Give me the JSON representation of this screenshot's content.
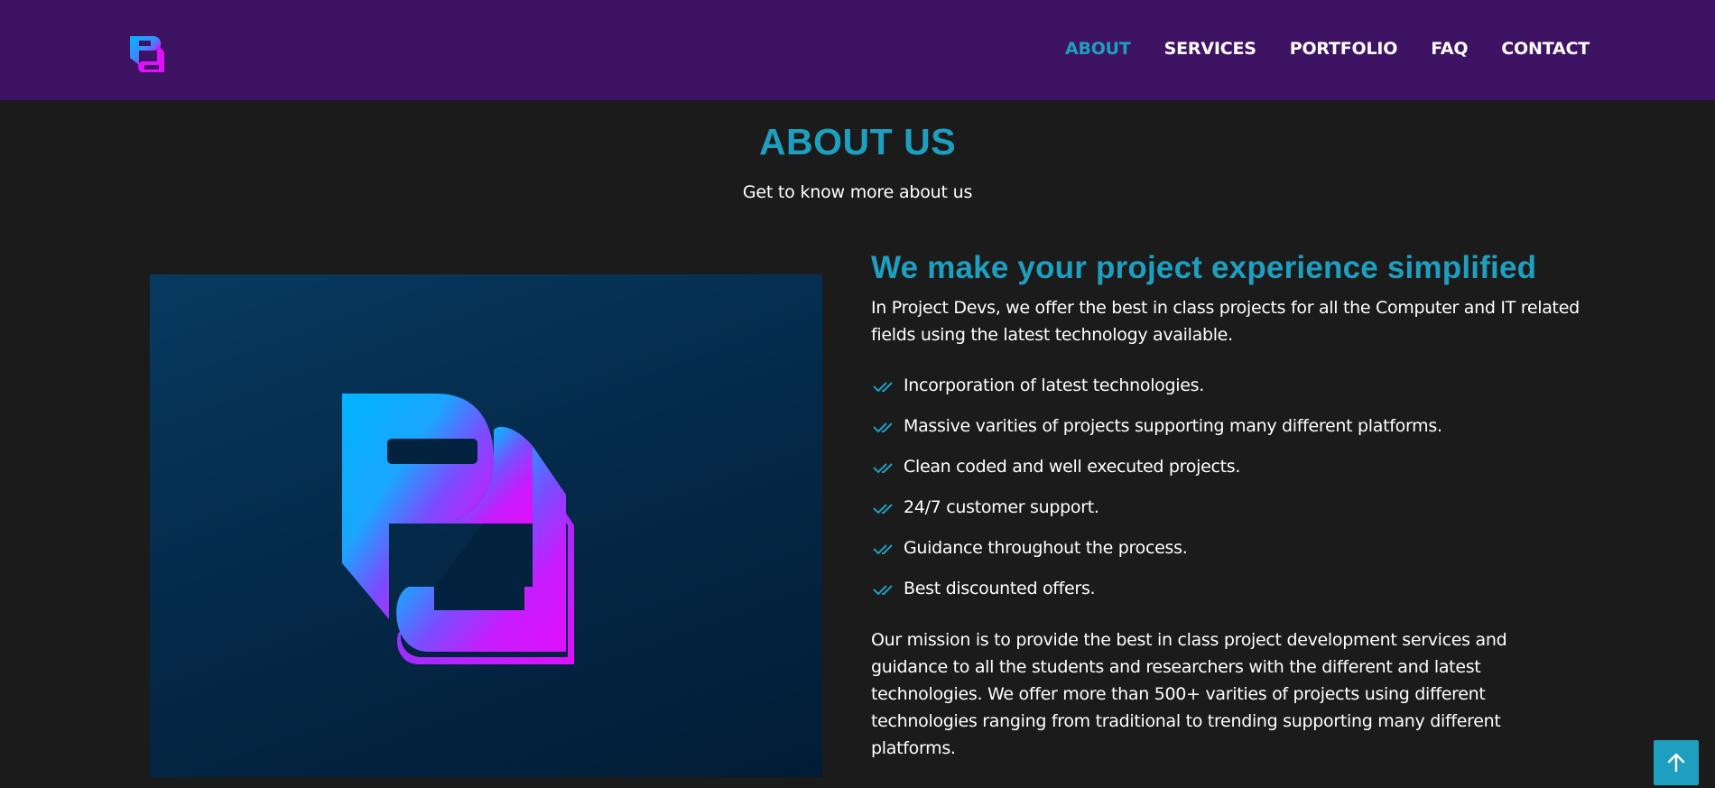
{
  "navbar": {
    "logo_alt": "Project Devs logo",
    "links": [
      {
        "label": "ABOUT",
        "active": true
      },
      {
        "label": "SERVICES",
        "active": false
      },
      {
        "label": "PORTFOLIO",
        "active": false
      },
      {
        "label": "FAQ",
        "active": false
      },
      {
        "label": "CONTACT",
        "active": false
      }
    ]
  },
  "about": {
    "title": "ABOUT US",
    "subtitle": "Get to know more about us",
    "heading": "We make your project experience simplified",
    "intro": "In Project Devs, we offer the best in class projects for all the Computer and IT related fields using the latest technology available.",
    "features": [
      "Incorporation of latest technologies.",
      "Massive varities of projects supporting many different platforms.",
      "Clean coded and well executed projects.",
      "24/7 customer support.",
      "Guidance throughout the process.",
      "Best discounted offers."
    ],
    "mission": "Our mission is to provide the best in class project development services and guidance to all the students and researchers with the different and latest technologies. We offer more than 500+ varities of projects using different technologies ranging from traditional to trending supporting many different platforms."
  },
  "icons": {
    "feature": "double-check-icon",
    "back_to_top": "arrow-up-icon"
  },
  "colors": {
    "accent": "#1f9fc0",
    "navbar_bg": "#3f1363",
    "page_bg": "#1b1b1b",
    "logo_blue": "#00b4ff",
    "logo_magenta": "#e010ff"
  }
}
